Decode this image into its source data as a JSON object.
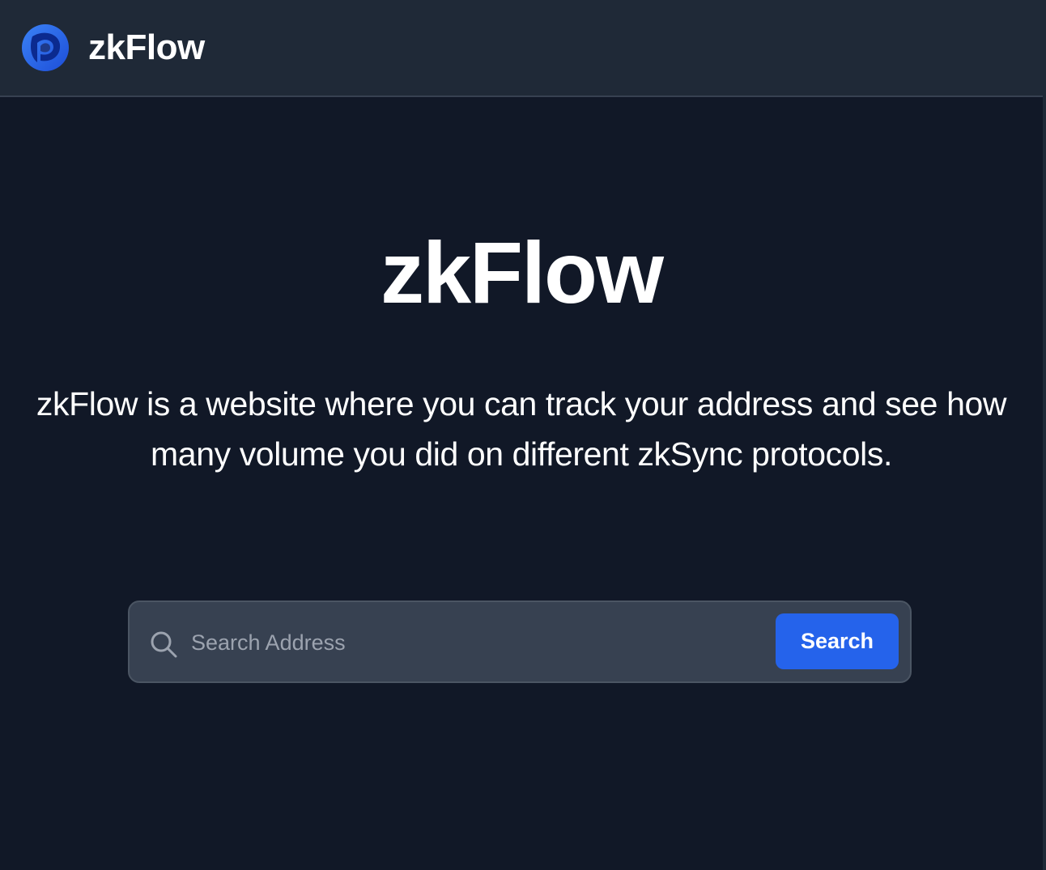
{
  "header": {
    "logo_icon": "zkflow-logo-icon",
    "brand_name": "zkFlow"
  },
  "hero": {
    "title": "zkFlow",
    "description": "zkFlow is a website where you can track your address and see how many volume you did on different zkSync protocols."
  },
  "search": {
    "icon": "search-icon",
    "placeholder": "Search Address",
    "value": "",
    "button_label": "Search"
  },
  "colors": {
    "page_background": "#111827",
    "navbar_background": "#1f2937",
    "search_bar_background": "#374151",
    "accent": "#2563eb",
    "text_primary": "#ffffff",
    "text_placeholder": "#9ca3af"
  }
}
